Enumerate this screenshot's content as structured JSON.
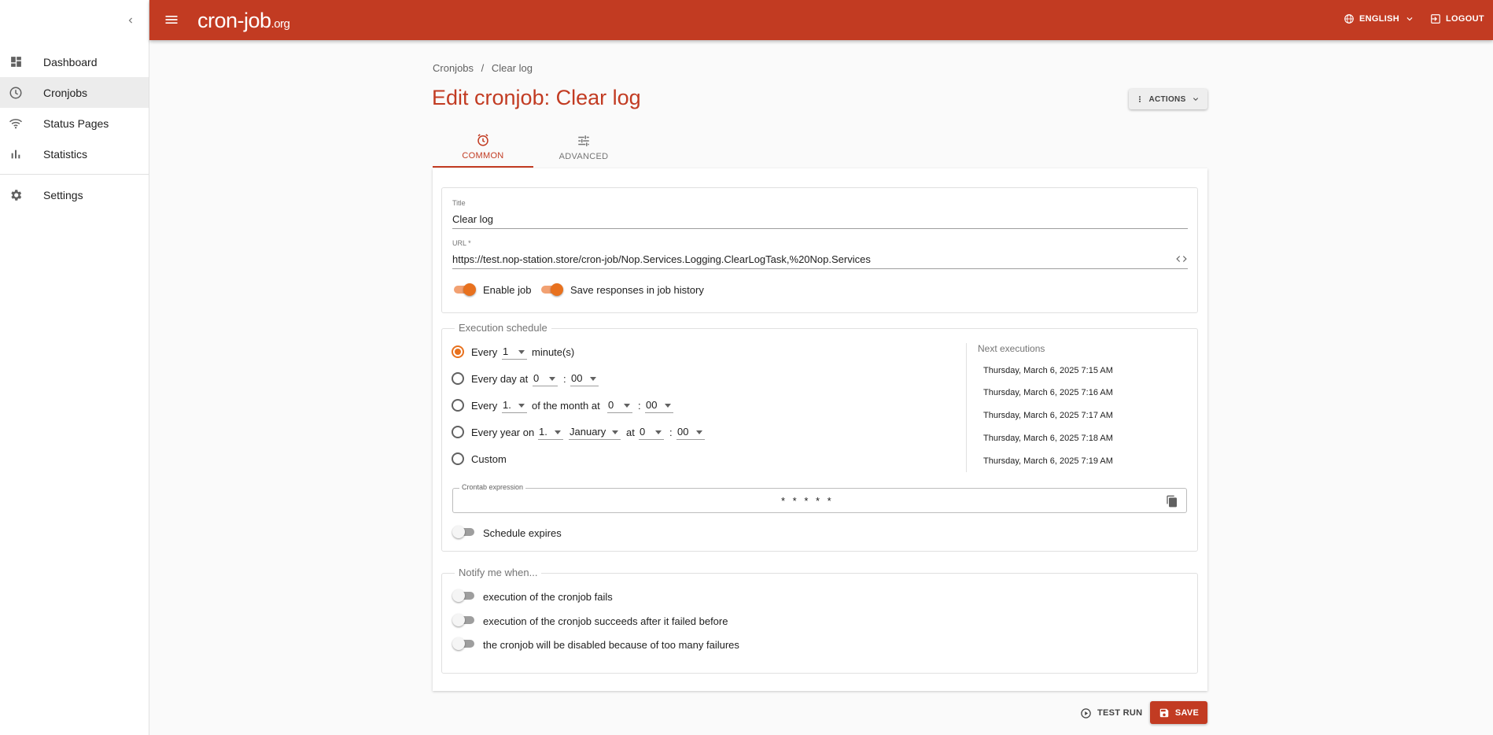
{
  "sidebar": {
    "items": [
      {
        "label": "Dashboard",
        "icon": "dashboard-icon"
      },
      {
        "label": "Cronjobs",
        "icon": "clock-icon"
      },
      {
        "label": "Status Pages",
        "icon": "wifi-icon"
      },
      {
        "label": "Statistics",
        "icon": "bar-chart-icon"
      },
      {
        "label": "Settings",
        "icon": "gear-icon"
      }
    ]
  },
  "topbar": {
    "logo_main": "cron-job",
    "logo_suffix": ".org",
    "language": "ENGLISH",
    "logout": "LOGOUT"
  },
  "breadcrumb": {
    "parent": "Cronjobs",
    "separator": "/",
    "current": "Clear log"
  },
  "page": {
    "title": "Edit cronjob: Clear log",
    "actions_label": "ACTIONS"
  },
  "tabs": [
    {
      "label": "COMMON"
    },
    {
      "label": "ADVANCED"
    }
  ],
  "common": {
    "title_label": "Title",
    "title_value": "Clear log",
    "url_label": "URL *",
    "url_value": "https://test.nop-station.store/cron-job/Nop.Services.Logging.ClearLogTask,%20Nop.Services",
    "enable_job_label": "Enable job",
    "save_responses_label": "Save responses in job history"
  },
  "schedule": {
    "legend": "Execution schedule",
    "every_label": "Every",
    "every_value": "1",
    "minutes_label": "minute(s)",
    "every_day_label": "Every day at",
    "day_hour": "0",
    "colon": ":",
    "day_minute": "00",
    "every_month_label": "Every",
    "month_day": "1.",
    "of_month_label": "of the month at",
    "month_hour": "0",
    "month_minute": "00",
    "every_year_label": "Every year on",
    "year_day": "1.",
    "year_month": "January",
    "at_label": "at",
    "year_hour": "0",
    "year_minute": "00",
    "custom_label": "Custom",
    "next_title": "Next executions",
    "next_executions": [
      "Thursday, March 6, 2025 7:15 AM",
      "Thursday, March 6, 2025 7:16 AM",
      "Thursday, March 6, 2025 7:17 AM",
      "Thursday, March 6, 2025 7:18 AM",
      "Thursday, March 6, 2025 7:19 AM"
    ],
    "crontab_label": "Crontab expression",
    "crontab_value": "* * * * *",
    "expires_label": "Schedule expires"
  },
  "notify": {
    "legend": "Notify me when...",
    "items": [
      "execution of the cronjob fails",
      "execution of the cronjob succeeds after it failed before",
      "the cronjob will be disabled because of too many failures"
    ]
  },
  "footer": {
    "test_run": "TEST RUN",
    "save": "SAVE"
  },
  "colors": {
    "brand": "#c23b22",
    "accent": "#e8711e"
  }
}
